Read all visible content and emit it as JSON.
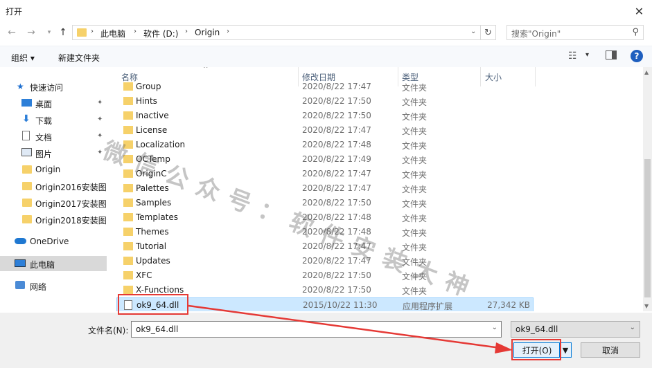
{
  "window": {
    "title": "打开",
    "close_glyph": "✕"
  },
  "address": {
    "breadcrumbs": [
      "此电脑",
      "软件 (D:)",
      "Origin"
    ],
    "search_placeholder": "搜索\"Origin\""
  },
  "toolbar": {
    "organize_label": "组织 ▾",
    "new_folder_label": "新建文件夹"
  },
  "sidebar": {
    "quick_access": "快速访问",
    "items": [
      {
        "label": "桌面",
        "icon": "desktop-icon",
        "pinned": true
      },
      {
        "label": "下载",
        "icon": "download-icon",
        "pinned": true
      },
      {
        "label": "文档",
        "icon": "document-icon",
        "pinned": true
      },
      {
        "label": "图片",
        "icon": "picture-icon",
        "pinned": true
      },
      {
        "label": "Origin",
        "icon": "folder-icon",
        "pinned": false
      },
      {
        "label": "Origin2016安装图片",
        "icon": "folder-icon",
        "pinned": false
      },
      {
        "label": "Origin2017安装图片",
        "icon": "folder-icon",
        "pinned": false
      },
      {
        "label": "Origin2018安装图片",
        "icon": "folder-icon",
        "pinned": false
      }
    ],
    "onedrive": "OneDrive",
    "this_pc": "此电脑",
    "network": "网络",
    "pin_glyph": "📌"
  },
  "columns": {
    "name": "名称",
    "date": "修改日期",
    "type": "类型",
    "size": "大小"
  },
  "files": [
    {
      "name": "Group",
      "date": "2020/8/22 17:47",
      "type": "文件夹",
      "size": ""
    },
    {
      "name": "Hints",
      "date": "2020/8/22 17:50",
      "type": "文件夹",
      "size": ""
    },
    {
      "name": "Inactive",
      "date": "2020/8/22 17:50",
      "type": "文件夹",
      "size": ""
    },
    {
      "name": "License",
      "date": "2020/8/22 17:47",
      "type": "文件夹",
      "size": ""
    },
    {
      "name": "Localization",
      "date": "2020/8/22 17:48",
      "type": "文件夹",
      "size": ""
    },
    {
      "name": "OCTemp",
      "date": "2020/8/22 17:49",
      "type": "文件夹",
      "size": ""
    },
    {
      "name": "OriginC",
      "date": "2020/8/22 17:47",
      "type": "文件夹",
      "size": ""
    },
    {
      "name": "Palettes",
      "date": "2020/8/22 17:47",
      "type": "文件夹",
      "size": ""
    },
    {
      "name": "Samples",
      "date": "2020/8/22 17:50",
      "type": "文件夹",
      "size": ""
    },
    {
      "name": "Templates",
      "date": "2020/8/22 17:48",
      "type": "文件夹",
      "size": ""
    },
    {
      "name": "Themes",
      "date": "2020/8/22 17:48",
      "type": "文件夹",
      "size": ""
    },
    {
      "name": "Tutorial",
      "date": "2020/8/22 17:47",
      "type": "文件夹",
      "size": ""
    },
    {
      "name": "Updates",
      "date": "2020/8/22 17:47",
      "type": "文件夹",
      "size": ""
    },
    {
      "name": "XFC",
      "date": "2020/8/22 17:50",
      "type": "文件夹",
      "size": ""
    },
    {
      "name": "X-Functions",
      "date": "2020/8/22 17:50",
      "type": "文件夹",
      "size": ""
    },
    {
      "name": "ok9_64.dll",
      "date": "2015/10/22 11:30",
      "type": "应用程序扩展",
      "size": "27,342 KB",
      "selected": true
    }
  ],
  "bottom": {
    "filename_label": "文件名(N):",
    "filename_value": "ok9_64.dll",
    "filter_value": "ok9_64.dll",
    "open_label": "打开(O)",
    "cancel_label": "取消"
  },
  "watermark": "微信公众号：软件安装大神",
  "colors": {
    "accent": "#0078d7",
    "selection": "#cce8ff",
    "annotation": "#e53935"
  }
}
